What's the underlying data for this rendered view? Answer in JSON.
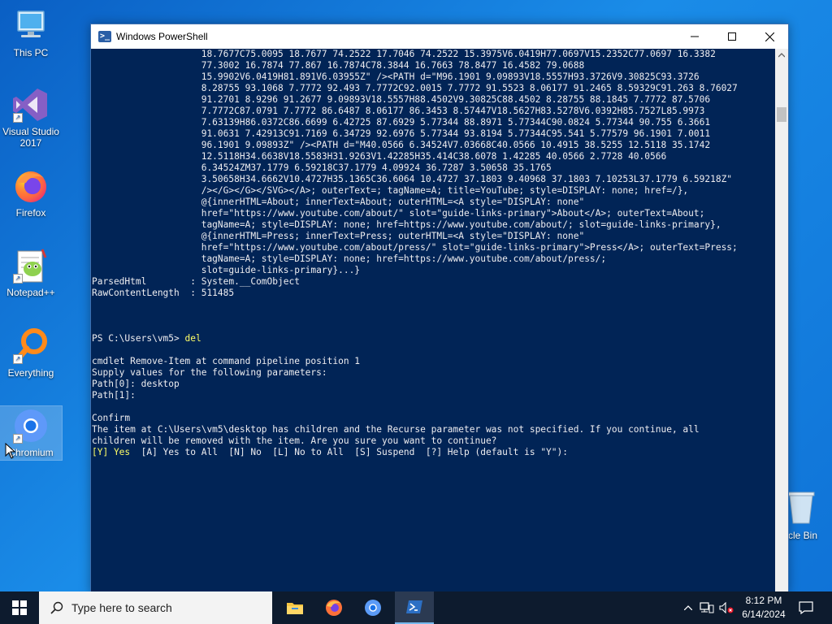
{
  "desktop": {
    "icons": [
      {
        "label": "This PC"
      },
      {
        "label": "Visual Studio 2017"
      },
      {
        "label": "Firefox"
      },
      {
        "label": "Notepad++"
      },
      {
        "label": "Everything"
      },
      {
        "label": "Chromium"
      }
    ],
    "recycle_bin": {
      "label": "cle Bin"
    }
  },
  "window": {
    "title": "Windows PowerShell",
    "console_lines": [
      "                    18.7677C75.0095 18.7677 74.2522 17.7046 74.2522 15.3975V6.0419H77.0697V15.2352C77.0697 16.3382",
      "                    77.3002 16.7874 77.867 16.7874C78.3844 16.7663 78.8477 16.4582 79.0688",
      "                    15.9902V6.0419H81.891V6.03955Z\" /><PATH d=\"M96.1901 9.09893V18.5557H93.3726V9.30825C93.3726",
      "                    8.28755 93.1068 7.7772 92.493 7.7772C92.0015 7.7772 91.5523 8.06177 91.2465 8.59329C91.263 8.76027",
      "                    91.2701 8.9296 91.2677 9.09893V18.5557H88.4502V9.30825C88.4502 8.28755 88.1845 7.7772 87.5706",
      "                    7.7772C87.0791 7.7772 86.6487 8.06177 86.3453 8.57447V18.5627H83.5278V6.0392H85.7527L85.9973",
      "                    7.63139H86.0372C86.6699 6.42725 87.6929 5.77344 88.8971 5.77344C90.0824 5.77344 90.755 6.3661",
      "                    91.0631 7.42913C91.7169 6.34729 92.6976 5.77344 93.8194 5.77344C95.541 5.77579 96.1901 7.0011",
      "                    96.1901 9.09893Z\" /><PATH d=\"M40.0566 6.34524V7.03668C40.0566 10.4915 38.5255 12.5118 35.1742",
      "                    12.5118H34.6638V18.5583H31.9263V1.42285H35.414C38.6078 1.42285 40.0566 2.7728 40.0566",
      "                    6.34524ZM37.1779 6.59218C37.1779 4.09924 36.7287 3.50658 35.1765",
      "                    3.50658H34.6662V10.4727H35.1365C36.6064 10.4727 37.1803 9.40968 37.1803 7.10253L37.1779 6.59218Z\"",
      "                    /></G></G></SVG></A>; outerText=; tagName=A; title=YouTube; style=DISPLAY: none; href=/},",
      "                    @{innerHTML=About; innerText=About; outerHTML=<A style=\"DISPLAY: none\"",
      "                    href=\"https://www.youtube.com/about/\" slot=\"guide-links-primary\">About</A>; outerText=About;",
      "                    tagName=A; style=DISPLAY: none; href=https://www.youtube.com/about/; slot=guide-links-primary},",
      "                    @{innerHTML=Press; innerText=Press; outerHTML=<A style=\"DISPLAY: none\"",
      "                    href=\"https://www.youtube.com/about/press/\" slot=\"guide-links-primary\">Press</A>; outerText=Press;",
      "                    tagName=A; style=DISPLAY: none; href=https://www.youtube.com/about/press/;",
      "                    slot=guide-links-primary}...}",
      "ParsedHtml        : System.__ComObject",
      "RawContentLength  : 511485",
      "",
      "",
      "",
      "PS C:\\Users\\vm5> ",
      "",
      "cmdlet Remove-Item at command pipeline position 1",
      "Supply values for the following parameters:",
      "Path[0]: desktop",
      "Path[1]:",
      "",
      "Confirm",
      "The item at C:\\Users\\vm5\\desktop has children and the Recurse parameter was not specified. If you continue, all",
      "children will be removed with the item. Are you sure you want to continue?",
      ""
    ],
    "typed_command": "del",
    "confirm_default": "[Y] Yes",
    "confirm_rest": "  [A] Yes to All  [N] No  [L] No to All  [S] Suspend  [?] Help (default is \"Y\"):"
  },
  "taskbar": {
    "search_placeholder": "Type here to search",
    "clock_time": "8:12 PM",
    "clock_date": "6/14/2024"
  }
}
